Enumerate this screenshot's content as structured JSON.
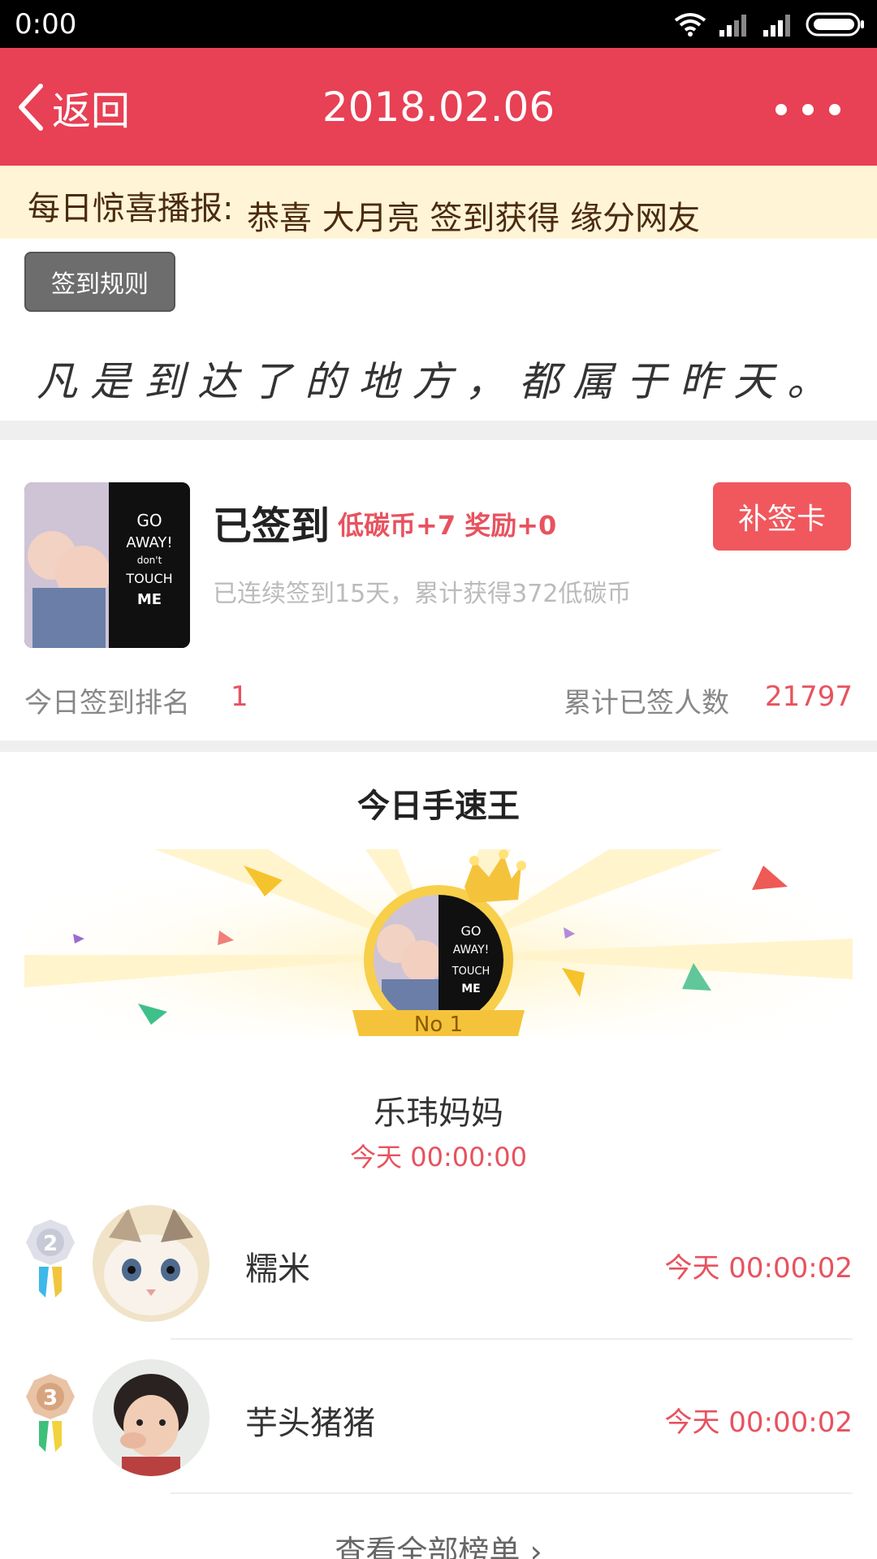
{
  "status_bar": {
    "time": "0:00"
  },
  "nav": {
    "back_label": "返回",
    "title": "2018.02.06"
  },
  "banner": {
    "tag": "每日惊喜播报:",
    "message": "恭喜 大月亮 签到获得 缘分网友"
  },
  "rules_button": "签到规则",
  "quote": "凡是到达了的地方，都属于昨天。",
  "sign_card": {
    "status": "已签到",
    "reward": "低碳币+7 奖励+0",
    "streak": "已连续签到15天，累计获得372低碳币",
    "makeup_button": "补签卡",
    "avatar_text": [
      "GO",
      "AWAY!",
      "don't",
      "TOUCH",
      "ME"
    ]
  },
  "stats": {
    "rank_label": "今日签到排名",
    "rank_value": "1",
    "total_label": "累计已签人数",
    "total_value": "21797"
  },
  "speed_king": {
    "title": "今日手速王",
    "badge": "No 1",
    "winner_name": "乐玮妈妈",
    "winner_time": "今天 00:00:00"
  },
  "ranking": [
    {
      "rank": "2",
      "name": "糯米",
      "time": "今天 00:00:02"
    },
    {
      "rank": "3",
      "name": "芋头猪猪",
      "time": "今天 00:00:02"
    }
  ],
  "view_all": "查看全部榜单 ›",
  "colors": {
    "primary": "#e84054",
    "accent": "#e8525f",
    "banner_bg": "#fff4d6",
    "gold": "#f5c33b"
  }
}
